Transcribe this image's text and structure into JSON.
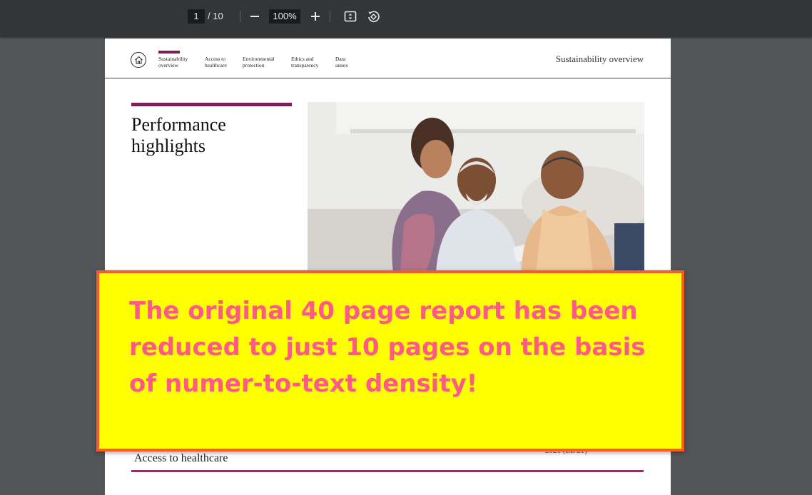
{
  "toolbar": {
    "current_page": "1",
    "page_total": "/ 10",
    "zoom": "100%",
    "icons": [
      "zoom-out-icon",
      "zoom-in-icon",
      "fit-page-icon",
      "rotate-icon"
    ]
  },
  "document": {
    "nav": [
      {
        "label_line1": "Sustainability",
        "label_line2": "overview",
        "active": true
      },
      {
        "label_line1": "Access to",
        "label_line2": "healthcare",
        "active": false
      },
      {
        "label_line1": "Environmental",
        "label_line2": "protection",
        "active": false
      },
      {
        "label_line1": "Ethics and",
        "label_line2": "transparency",
        "active": false
      },
      {
        "label_line1": "Data",
        "label_line2": "annex",
        "active": false
      }
    ],
    "header_right": "Sustainability overview",
    "title_line1": "Performance",
    "title_line2": "highlights",
    "section_heading": "Access to healthcare",
    "faint_text": "2021 (LL 21)",
    "accent_color": "#7a1f55",
    "section_rule_color": "#c0137c"
  },
  "banner": {
    "line1": "The original 40 page report has been",
    "line2": "reduced to just 10 pages on the basis",
    "line3": "of numer-to-text density!",
    "background": "#ffff00",
    "border_color": "#ff5a1f",
    "text_color": "#ff5a87"
  }
}
